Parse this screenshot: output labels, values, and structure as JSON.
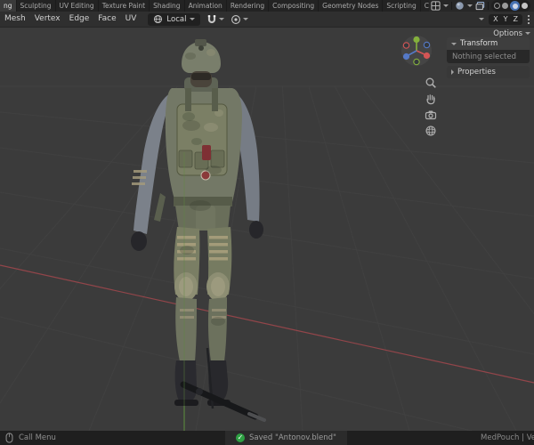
{
  "colors": {
    "accent_blue": "#4772b3",
    "axis_x_red": "#b0494f",
    "axis_y_green": "#5d8b3f",
    "saved_green": "#2ea043",
    "viewport_bg": "#3b3b3b"
  },
  "topbar": {
    "workspace_tabs": [
      {
        "label": "ng",
        "active": true
      },
      {
        "label": "Sculpting",
        "active": false
      },
      {
        "label": "UV Editing",
        "active": false
      },
      {
        "label": "Texture Paint",
        "active": false
      },
      {
        "label": "Shading",
        "active": false
      },
      {
        "label": "Animation",
        "active": false
      },
      {
        "label": "Rendering",
        "active": false
      },
      {
        "label": "Compositing",
        "active": false
      },
      {
        "label": "Geometry Nodes",
        "active": false
      },
      {
        "label": "Scripting",
        "active": false
      },
      {
        "label": "Cycles",
        "active": false
      }
    ],
    "add_tab_label": "+"
  },
  "viewport_header": {
    "menus": [
      "Mesh",
      "Vertex",
      "Edge",
      "Face",
      "UV"
    ],
    "orientation_value": "Local",
    "mirror_axes": [
      "X",
      "Y",
      "Z"
    ],
    "options_label": "Options"
  },
  "side_panel": {
    "transform_title": "Transform",
    "empty_text": "Nothing selected",
    "properties_title": "Properties"
  },
  "status_bar": {
    "left_label": "Call Menu",
    "save_message": "Saved \"Antonov.blend\"",
    "object_stats": "MedPouch | Vert"
  },
  "icons": [
    "editor-grid-icon",
    "scene-icon",
    "view-layer-icon",
    "wireframe-shading-icon",
    "solid-shading-icon",
    "material-shading-icon",
    "rendered-shading-icon",
    "orientation-icon",
    "snap-magnet-icon",
    "proportional-edit-icon",
    "overflow-dots-icon",
    "navigation-gizmo",
    "zoom-icon",
    "pan-hand-icon",
    "camera-view-icon",
    "ortho-grid-icon",
    "mouse-icon",
    "saved-check-icon"
  ]
}
